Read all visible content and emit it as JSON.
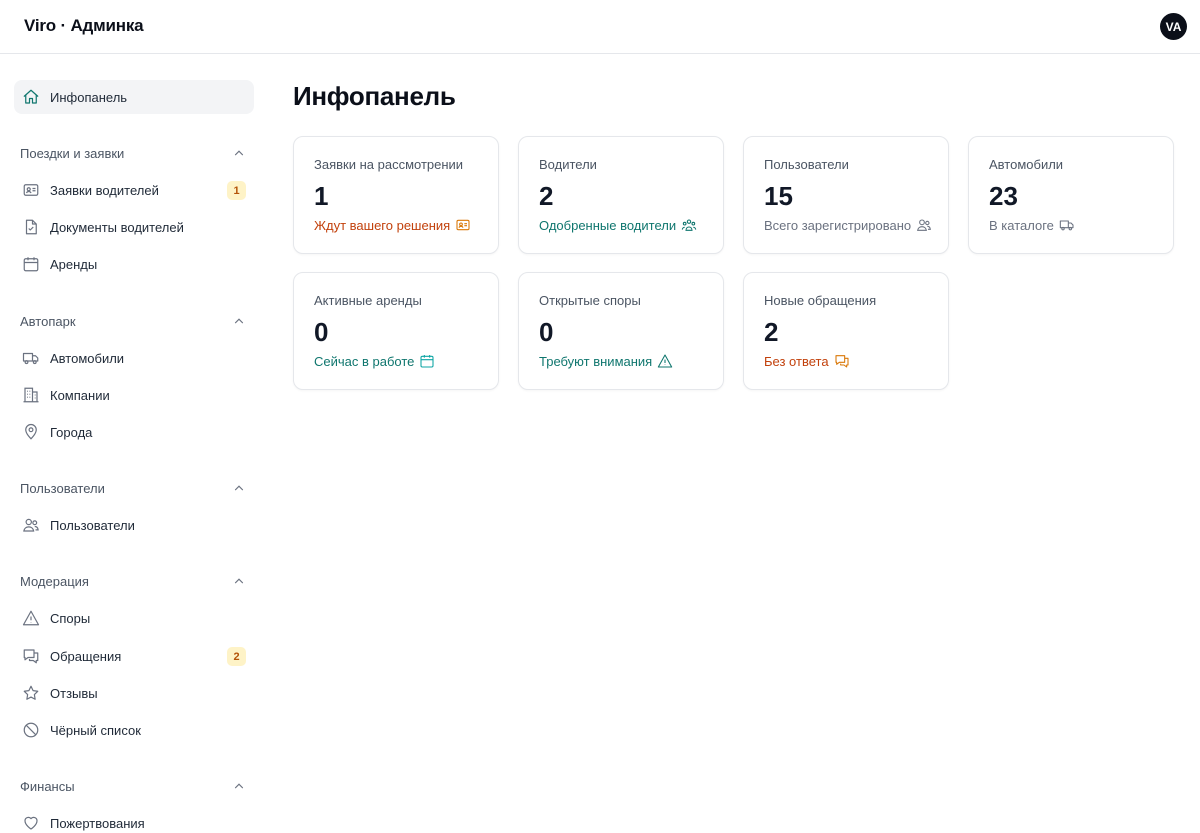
{
  "header": {
    "brand": "Viro · Админка",
    "avatar_initials": "VA"
  },
  "sidebar": {
    "dashboard": {
      "label": "Инфопанель",
      "icon": "home-icon",
      "active": true
    },
    "sections": [
      {
        "title": "Поездки и заявки",
        "items": [
          {
            "label": "Заявки водителей",
            "icon": "id-card-icon",
            "badge": "1"
          },
          {
            "label": "Документы водителей",
            "icon": "document-icon"
          },
          {
            "label": "Аренды",
            "icon": "calendar-icon"
          }
        ]
      },
      {
        "title": "Автопарк",
        "items": [
          {
            "label": "Автомобили",
            "icon": "truck-icon"
          },
          {
            "label": "Компании",
            "icon": "building-icon"
          },
          {
            "label": "Города",
            "icon": "map-pin-icon"
          }
        ]
      },
      {
        "title": "Пользователи",
        "items": [
          {
            "label": "Пользователи",
            "icon": "users-icon"
          }
        ]
      },
      {
        "title": "Модерация",
        "items": [
          {
            "label": "Споры",
            "icon": "warning-icon"
          },
          {
            "label": "Обращения",
            "icon": "chat-icon",
            "badge": "2"
          },
          {
            "label": "Отзывы",
            "icon": "star-icon"
          },
          {
            "label": "Чёрный список",
            "icon": "ban-icon"
          }
        ]
      },
      {
        "title": "Финансы",
        "items": [
          {
            "label": "Пожертвования",
            "icon": "heart-icon"
          }
        ]
      }
    ]
  },
  "main": {
    "title": "Инфопанель",
    "cards": [
      {
        "label": "Заявки на рассмотрении",
        "value": "1",
        "foot": "Ждут вашего решения",
        "icon": "id-card-icon",
        "color": "#c2410c"
      },
      {
        "label": "Водители",
        "value": "2",
        "foot": "Одобренные водители",
        "icon": "user-group-icon",
        "color": "#0f766e"
      },
      {
        "label": "Пользователи",
        "value": "15",
        "foot": "Всего зарегистрировано",
        "icon": "users-icon",
        "color": "#6b7280"
      },
      {
        "label": "Автомобили",
        "value": "23",
        "foot": "В каталоге",
        "icon": "truck-icon",
        "color": "#6b7280"
      },
      {
        "label": "Активные аренды",
        "value": "0",
        "foot": "Сейчас в работе",
        "icon": "calendar-icon",
        "color": "#0f766e"
      },
      {
        "label": "Открытые споры",
        "value": "0",
        "foot": "Требуют внимания",
        "icon": "warning-icon",
        "color": "#0f766e"
      },
      {
        "label": "Новые обращения",
        "value": "2",
        "foot": "Без ответа",
        "icon": "chat-icon",
        "color": "#d97706"
      }
    ]
  }
}
